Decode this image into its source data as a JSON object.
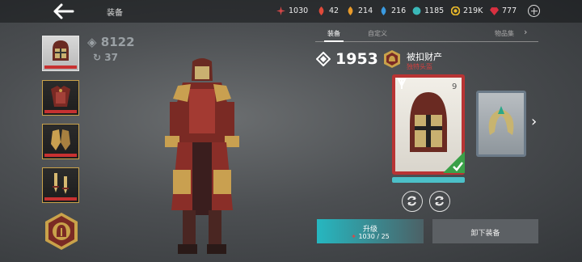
{
  "header": {
    "title": "装备",
    "currencies": [
      {
        "icon": "red-crystal-icon",
        "value": "1030",
        "color": "#d84848"
      },
      {
        "icon": "red-flame-icon",
        "value": "42",
        "color": "#e04a3a"
      },
      {
        "icon": "orange-flame-icon",
        "value": "214",
        "color": "#e89a2a"
      },
      {
        "icon": "blue-flame-icon",
        "value": "216",
        "color": "#3a9ae0"
      },
      {
        "icon": "teal-orb-icon",
        "value": "1185",
        "color": "#3ab8b8"
      },
      {
        "icon": "gold-coin-icon",
        "value": "219K",
        "color": "#e8b82a"
      },
      {
        "icon": "ruby-icon",
        "value": "777",
        "color": "#d83040"
      }
    ]
  },
  "left_panel": {
    "total_power": "8122",
    "upgrade_count": "37",
    "slots": [
      "helmet",
      "chest-armor",
      "gauntlets",
      "weapons"
    ]
  },
  "tabs": [
    "装备",
    "自定义",
    "物品集"
  ],
  "item": {
    "power": "1953",
    "name": "被扣财产",
    "subtitle": "独特头盔"
  },
  "buttons": {
    "upgrade_label": "升级",
    "upgrade_cost": "1030 / 25",
    "unequip_label": "卸下装备"
  },
  "colors": {
    "accent": "#26b7c0",
    "card_rarity": "#b83434",
    "slot_border": "#c9a24a"
  }
}
